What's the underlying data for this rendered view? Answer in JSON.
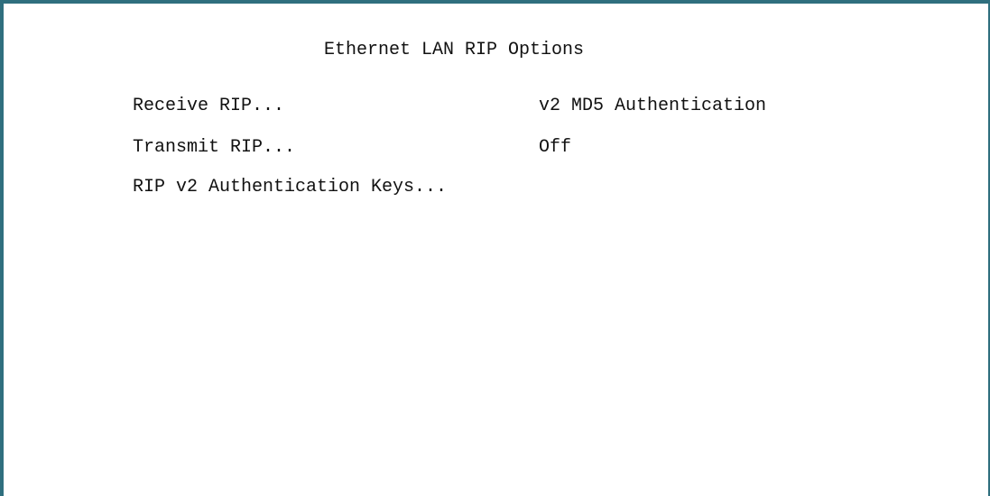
{
  "screen": {
    "title": "Ethernet LAN RIP Options",
    "items": [
      {
        "label": "Receive RIP...",
        "value": "v2 MD5 Authentication"
      },
      {
        "label": "Transmit RIP...",
        "value": "Off"
      },
      {
        "label": "RIP v2 Authentication Keys...",
        "value": ""
      }
    ]
  },
  "colors": {
    "border": "#2f6f7e",
    "background": "#ffffff",
    "text": "#111111"
  }
}
